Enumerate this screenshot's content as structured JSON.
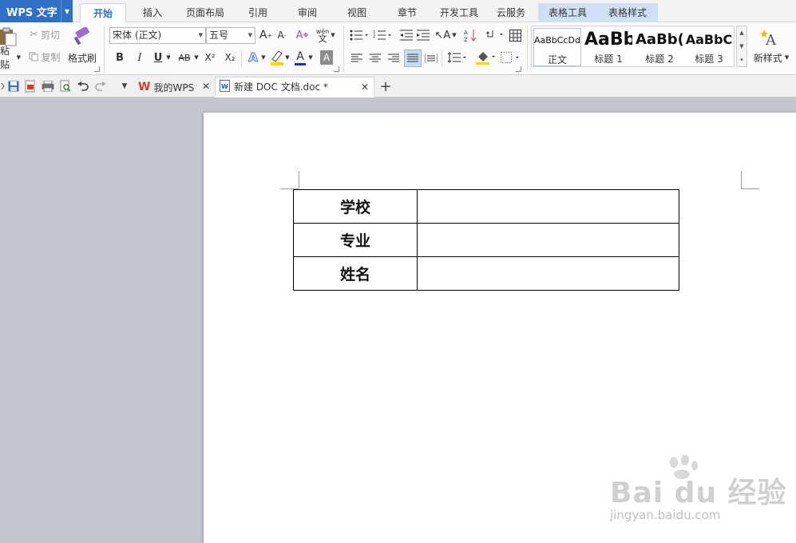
{
  "app": {
    "title": "WPS 文字"
  },
  "menu_tabs": [
    {
      "label": "开始"
    },
    {
      "label": "插入"
    },
    {
      "label": "页面布局"
    },
    {
      "label": "引用"
    },
    {
      "label": "审阅"
    },
    {
      "label": "视图"
    },
    {
      "label": "章节"
    },
    {
      "label": "开发工具"
    },
    {
      "label": "云服务"
    },
    {
      "label": "表格工具"
    },
    {
      "label": "表格样式"
    }
  ],
  "ribbon": {
    "clipboard": {
      "paste": "粘贴",
      "cut": "剪切",
      "copy": "复制",
      "format_painter": "格式刷"
    },
    "font": {
      "name": "宋体 (正文)",
      "size": "五号",
      "pinyin_glyph": "wén",
      "bold": "B",
      "italic": "I",
      "underline": "U",
      "strike": "AB",
      "superscript": "X²",
      "subscript": "X₂",
      "font_color": "A",
      "char_shading": "A"
    },
    "styles": [
      {
        "preview": "AaBbCcDd",
        "label": "正文"
      },
      {
        "preview": "AaBb",
        "label": "标题 1"
      },
      {
        "preview": "AaBb(",
        "label": "标题 2"
      },
      {
        "preview": "AaBbC",
        "label": "标题 3"
      }
    ],
    "new_style": "新样式"
  },
  "doc_tabs": [
    {
      "label": "我的WPS"
    },
    {
      "label": "新建 DOC 文档.doc *"
    }
  ],
  "table_rows": [
    {
      "label": "学校",
      "value": ""
    },
    {
      "label": "专业",
      "value": ""
    },
    {
      "label": "姓名",
      "value": ""
    }
  ],
  "watermark": {
    "main": "Bai du 经验",
    "sub": "jingyan.baidu.com"
  },
  "colors": {
    "app_blue": "#2f6fc4",
    "font_color_underline": "#1a2bd4",
    "highlight_yellow": "#f5d800",
    "wps_red": "#d93a2b"
  }
}
